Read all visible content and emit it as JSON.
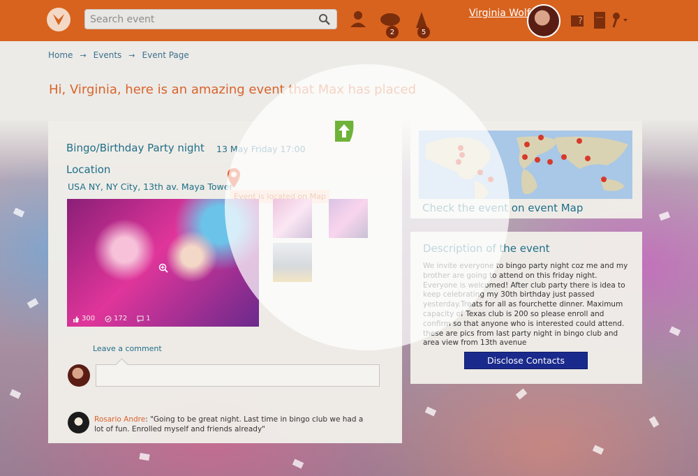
{
  "header": {
    "search_placeholder": "Search event",
    "messages_badge": "2",
    "notifications_badge": "5",
    "username": "Virginia Wolf"
  },
  "breadcrumb": {
    "home": "Home",
    "sep1": "→",
    "events": "Events",
    "sep2": "→",
    "event_page": "Event Page"
  },
  "greeting": "Hi, Virginia, here is an amazing event that Max has placed",
  "event": {
    "title": "Bingo/Birthday Party night",
    "date": "13 May Friday 17:00",
    "location_label": "Location",
    "location_value": "USA NY, NY City, 13th av. Maya Tower",
    "map_tooltip": "Event is located on Map",
    "likes": "300",
    "views": "172",
    "comments": "1"
  },
  "comments": {
    "leave_comment": "Leave a comment",
    "reply_author": "Rosario Andre",
    "reply_text": ": \"Going to be great night. Last time in bingo club we had a lot of fun. Enrolled myself and friends already\""
  },
  "map_panel": {
    "link": "Check the event on event Map"
  },
  "description": {
    "title": "Description of the event",
    "text": "We invite everyone to bingo party night coz me and my brother are going to attend on this friday night. Everyone is welcomed! After club party there is idea to keep celebrating my 30th birthday just passed yesterday.Treats for all as fourchette dinner. Maximum capacity of Texas club is 200 so please enroll and confirm so that anyone who is interested could attend. these are pics from last party night in bingo club and area view from 13th avenue",
    "button": "Disclose Contacts"
  },
  "colors": {
    "topbar": "#d8631f",
    "accent_text": "#1e6e87",
    "greeting": "#d8632c",
    "button": "#1a2a8c"
  }
}
